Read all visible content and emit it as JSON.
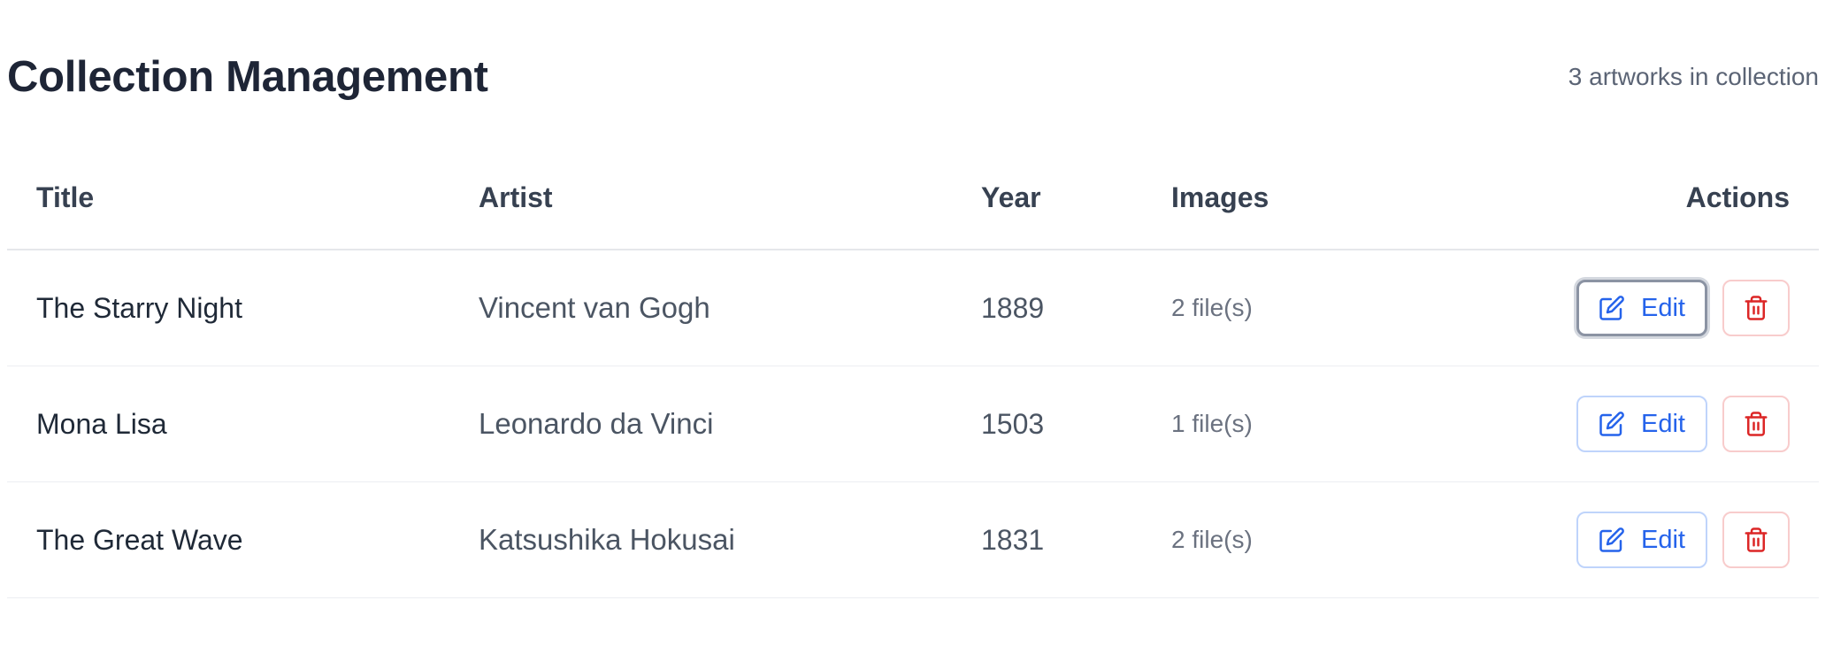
{
  "header": {
    "title": "Collection Management",
    "count_text": "3 artworks in collection"
  },
  "table": {
    "columns": {
      "title": "Title",
      "artist": "Artist",
      "year": "Year",
      "images": "Images",
      "actions": "Actions"
    },
    "rows": [
      {
        "title": "The Starry Night",
        "artist": "Vincent van Gogh",
        "year": "1889",
        "images": "2 file(s)",
        "edit_label": "Edit"
      },
      {
        "title": "Mona Lisa",
        "artist": "Leonardo da Vinci",
        "year": "1503",
        "images": "1 file(s)",
        "edit_label": "Edit"
      },
      {
        "title": "The Great Wave",
        "artist": "Katsushika Hokusai",
        "year": "1831",
        "images": "2 file(s)",
        "edit_label": "Edit"
      }
    ]
  },
  "icons": {
    "edit": "edit-icon",
    "delete": "trash-icon"
  },
  "colors": {
    "edit_accent": "#2563eb",
    "delete_accent": "#dc2626"
  }
}
